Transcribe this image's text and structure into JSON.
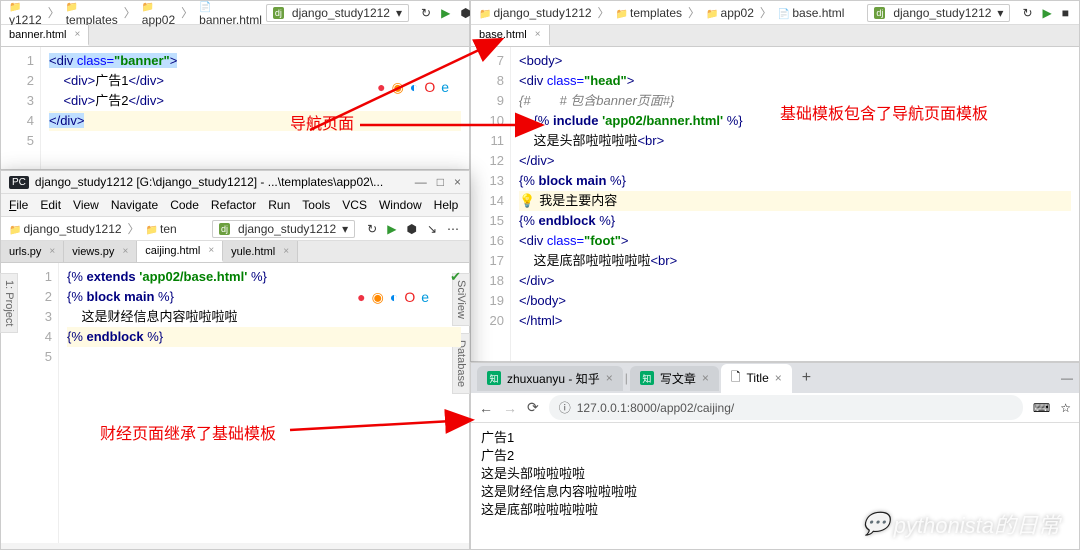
{
  "top_left": {
    "breadcrumb": [
      "y1212",
      "templates",
      "app02",
      "banner.html"
    ],
    "config": "django_study1212",
    "tab": "banner.html",
    "code": {
      "l1": "",
      "l2_open": "<div ",
      "l2_attr": "class=",
      "l2_val": "\"banner\"",
      "l2_close": ">",
      "l3_open": "<div>",
      "l3_txt": "广告1",
      "l3_close": "</div>",
      "l4_open": "<div>",
      "l4_txt": "广告2",
      "l4_close": "</div>",
      "l5": "</div>"
    }
  },
  "top_right": {
    "breadcrumb": [
      "django_study1212",
      "templates",
      "app02",
      "base.html"
    ],
    "config": "django_study1212",
    "tab": "base.html",
    "code": {
      "n7": "7",
      "l7": "<body>",
      "n8": "8",
      "l8_open": "<div ",
      "l8_attr": "class=",
      "l8_val": "\"head\"",
      "l8_close": ">",
      "n9": "9",
      "l9": "{#        # 包含banner页面#}",
      "n10": "10",
      "l10_a": "{% ",
      "l10_b": "include ",
      "l10_c": "'app02/banner.html' ",
      "l10_d": "%}",
      "n11": "11",
      "l11_a": "这是头部啦啦啦啦",
      "l11_b": "<br>",
      "n12": "12",
      "l12": "</div>",
      "n13": "13",
      "l13_a": "{% ",
      "l13_b": "block main ",
      "l13_c": "%}",
      "n14": "14",
      "l14": "我是主要内容",
      "n15": "15",
      "l15_a": "{% ",
      "l15_b": "endblock ",
      "l15_c": "%}",
      "n16": "16",
      "l16_open": "<div ",
      "l16_attr": "class=",
      "l16_val": "\"foot\"",
      "l16_close": ">",
      "n17": "17",
      "l17_a": "这是底部啦啦啦啦啦",
      "l17_b": "<br>",
      "n18": "18",
      "l18": "</div>",
      "n19": "19",
      "l19": "</body>",
      "n20": "20",
      "l20": "</html>"
    }
  },
  "popup": {
    "title": "django_study1212 [G:\\django_study1212] - ...\\templates\\app02\\...",
    "menu": {
      "file": "File",
      "edit": "Edit",
      "view": "View",
      "navigate": "Navigate",
      "code": "Code",
      "refactor": "Refactor",
      "run": "Run",
      "tools": "Tools",
      "vcs": "VCS",
      "window": "Window",
      "help": "Help"
    },
    "breadcrumb": [
      "django_study1212",
      "ten"
    ],
    "config": "django_study1212",
    "tabs": {
      "t1": "urls.py",
      "t2": "views.py",
      "t3": "caijing.html",
      "t4": "yule.html"
    },
    "code": {
      "l1_a": "{% ",
      "l1_b": "extends ",
      "l1_c": "'app02/base.html' ",
      "l1_d": "%}",
      "l2": "",
      "l3_a": "{% ",
      "l3_b": "block main ",
      "l3_c": "%}",
      "l4": "这是财经信息内容啦啦啦啦",
      "l5_a": "{% ",
      "l5_b": "endblock ",
      "l5_c": "%}"
    },
    "side": {
      "project": "1: Project",
      "sciview": "SciView",
      "database": "Database"
    }
  },
  "browser": {
    "tabs": {
      "t1": "zhuxuanyu - 知乎",
      "t2": "写文章",
      "t3": "Title"
    },
    "url": "127.0.0.1:8000/app02/caijing/",
    "body": [
      "广告1",
      "广告2",
      "这是头部啦啦啦啦",
      "这是财经信息内容啦啦啦啦",
      "这是底部啦啦啦啦啦"
    ]
  },
  "annotations": {
    "a1": "导航页面",
    "a2": "基础模板包含了导航页面模板",
    "a3": "财经页面继承了基础模板"
  },
  "watermark": "pythonista的日常"
}
